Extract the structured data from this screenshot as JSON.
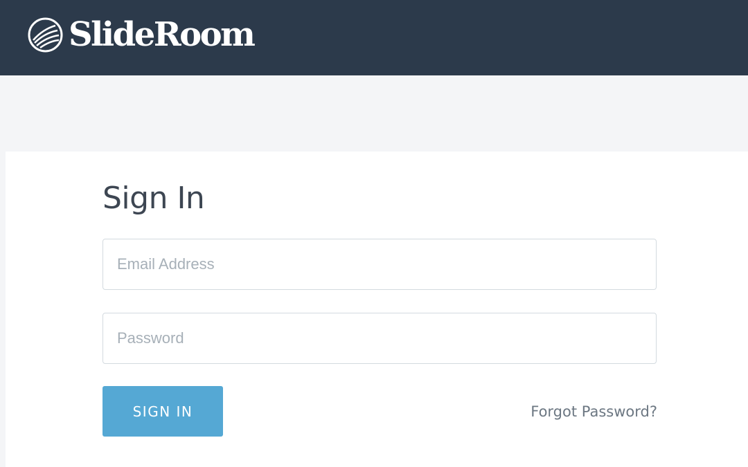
{
  "header": {
    "brand_name": "SlideRoom",
    "logo_icon": "slideroom-logo-icon"
  },
  "signin": {
    "title": "Sign In",
    "email": {
      "value": "",
      "placeholder": "Email Address"
    },
    "password": {
      "value": "",
      "placeholder": "Password"
    },
    "submit_label": "SIGN IN",
    "forgot_label": "Forgot Password?"
  },
  "colors": {
    "header_bg": "#2c3a4b",
    "page_bg": "#f4f5f7",
    "button_bg": "#55a8d4",
    "title_text": "#3d4652",
    "link_text": "#6c7782"
  }
}
